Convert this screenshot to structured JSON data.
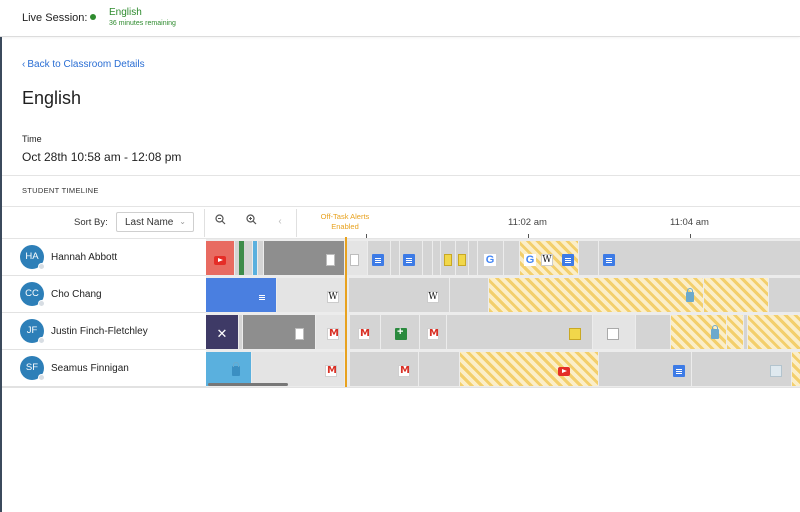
{
  "live_session": {
    "label": "Live Session:",
    "class_name": "English",
    "remaining": "36 minutes remaining"
  },
  "header": {
    "back_link": "Back to Classroom Details",
    "title": "English",
    "time_label": "Time",
    "time_value": "Oct 28th 10:58 am - 12:08 pm"
  },
  "timeline": {
    "section_title": "STUDENT TIMELINE",
    "sort_label": "Sort By:",
    "sort_value": "Last Name",
    "off_task_alert": "Off-Task Alerts Enabled",
    "time_ticks": [
      "11:02 am",
      "11:04 am"
    ]
  },
  "students": [
    {
      "initials": "HA",
      "name": "Hannah Abbott"
    },
    {
      "initials": "CC",
      "name": "Cho Chang"
    },
    {
      "initials": "JF",
      "name": "Justin Finch-Fletchley"
    },
    {
      "initials": "SF",
      "name": "Seamus Finnigan"
    }
  ],
  "colors": {
    "accent": "#2a6ed4",
    "live": "#2e8b2e",
    "alert": "#e8a21f",
    "avatar": "#2d7fb8"
  },
  "icons": [
    "chevron-left-icon",
    "zoom-out-icon",
    "zoom-in-icon",
    "arrow-left-icon",
    "chevron-down-icon",
    "google-docs-icon",
    "gmail-icon",
    "wikipedia-icon",
    "google-icon",
    "youtube-icon",
    "google-sheets-icon",
    "lock-icon",
    "page-icon"
  ]
}
